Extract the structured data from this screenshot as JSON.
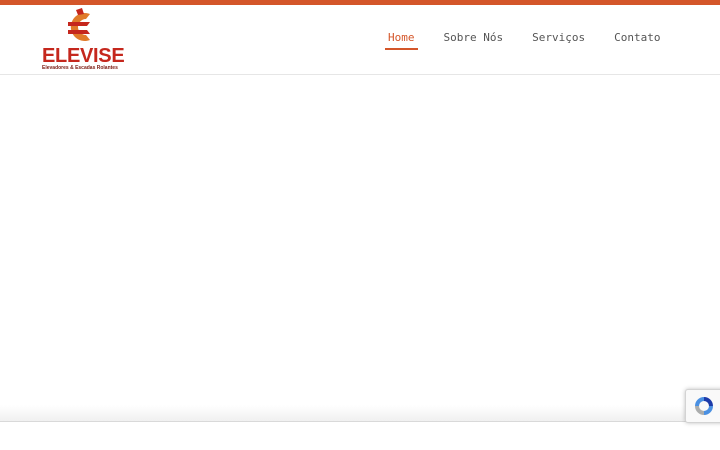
{
  "brand": {
    "name": "ELEVISE",
    "tagline": "Elevadores & Escadas Rolantes",
    "primary_color": "#d4562a",
    "logo_red": "#c5271d",
    "logo_orange": "#e07b2a"
  },
  "nav": {
    "items": [
      {
        "label": "Home",
        "active": true
      },
      {
        "label": "Sobre Nós",
        "active": false
      },
      {
        "label": "Serviços",
        "active": false
      },
      {
        "label": "Contato",
        "active": false
      }
    ]
  },
  "widgets": {
    "recaptcha_icon": "recaptcha-icon"
  }
}
